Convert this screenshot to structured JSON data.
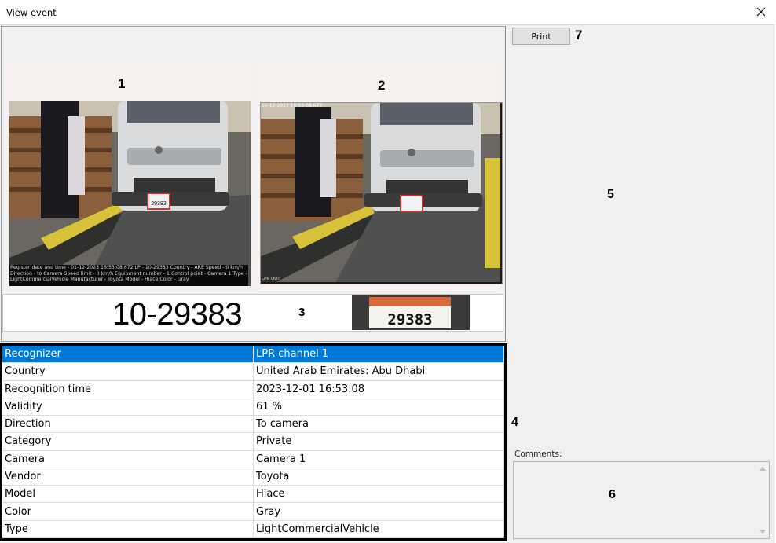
{
  "window": {
    "title": "View event"
  },
  "markers": {
    "m1": "1",
    "m2": "2",
    "m3": "3",
    "m4": "4",
    "m5": "5",
    "m6": "6",
    "m7": "7"
  },
  "photos": {
    "caption_lines": [
      "Register date and time - 01-12-2023 16:53:08.672 LP - 10-29383 Country - ARE Speed - 0 km/h",
      "Direction - to Camera Speed limit - 0 km/h Equipment number - 1 Control point - Camera 1 Type -",
      "LightCommercialVehicle          Manufacturer - Toyota  Model - Hiace   Color - Gray"
    ],
    "overview_timestamp": "01-12-2023 16:53:08.672",
    "overview_tag": "LPR OUT",
    "vehicle_plate_text": "29383"
  },
  "plate": {
    "recognized": "10-29383",
    "crop_text": "29383"
  },
  "details": {
    "rows": [
      {
        "key": "Recognizer",
        "value": "LPR channel  1"
      },
      {
        "key": "Country",
        "value": "United Arab Emirates: Abu Dhabi"
      },
      {
        "key": "Recognition time",
        "value": "2023-12-01 16:53:08"
      },
      {
        "key": "Validity",
        "value": "61 %"
      },
      {
        "key": "Direction",
        "value": "To camera"
      },
      {
        "key": "Category",
        "value": "Private"
      },
      {
        "key": "Camera",
        "value": "Camera 1"
      },
      {
        "key": "Vendor",
        "value": "Toyota"
      },
      {
        "key": "Model",
        "value": "Hiace"
      },
      {
        "key": "Color",
        "value": "Gray"
      },
      {
        "key": "Type",
        "value": "LightCommercialVehicle"
      }
    ]
  },
  "actions": {
    "print_label": "Print"
  },
  "comments": {
    "label": "Comments:",
    "value": ""
  },
  "icons": {
    "close": "close-icon",
    "scroll_up": "scroll-up-icon",
    "scroll_down": "scroll-down-icon"
  },
  "colors": {
    "selection": "#0078d7",
    "window_bg": "#f0f0f0",
    "table_frame": "#000000"
  }
}
